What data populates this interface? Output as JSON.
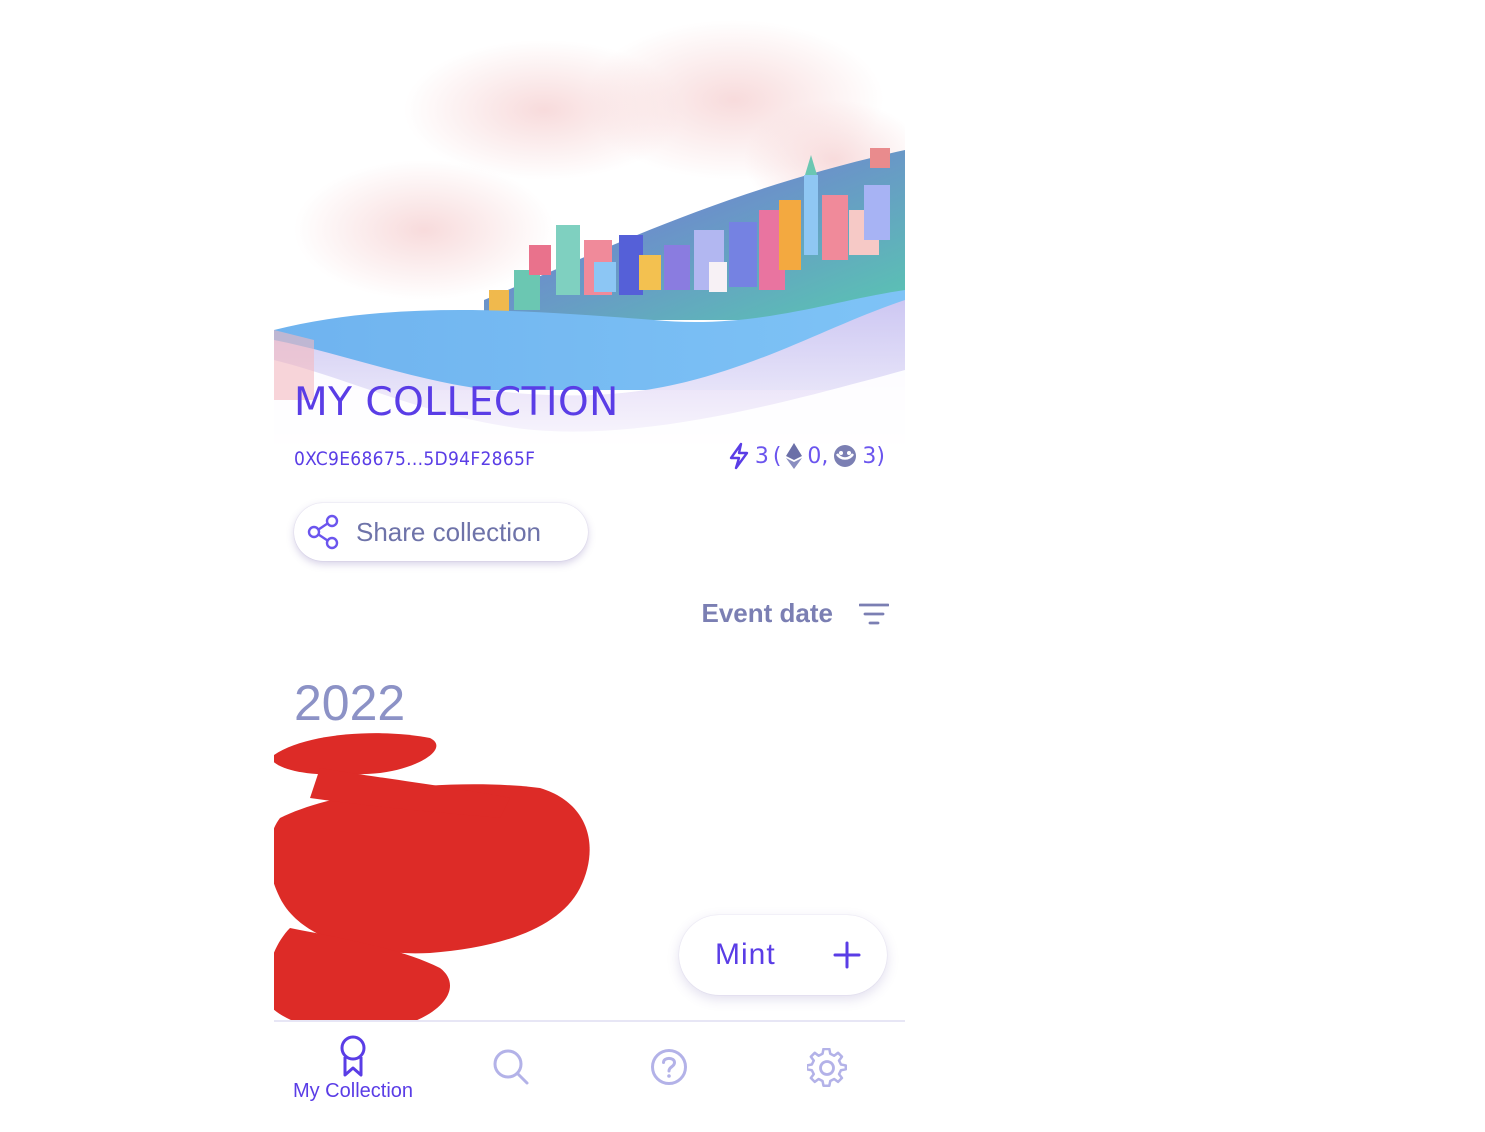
{
  "header": {
    "title": "MY COLLECTION",
    "address": "0XC9E68675...5D94F2865F"
  },
  "stats": {
    "total": "3",
    "open_paren": "(",
    "eth_count": "0,",
    "gnosis_count": "3)",
    "bolt_icon": "lightning-bolt-icon",
    "eth_icon": "ethereum-icon",
    "gnosis_icon": "gnosis-icon"
  },
  "share": {
    "label": "Share collection",
    "icon": "share-icon"
  },
  "sort": {
    "label": "Event date",
    "icon": "filter-lines-icon"
  },
  "year_heading": "2022",
  "mint": {
    "label": "Mint",
    "icon": "plus-icon"
  },
  "tabs": [
    {
      "label": "My Collection",
      "icon": "badge-ribbon-icon",
      "active": true
    },
    {
      "label": "",
      "icon": "search-icon",
      "active": false
    },
    {
      "label": "",
      "icon": "help-circle-icon",
      "active": false
    },
    {
      "label": "",
      "icon": "gear-icon",
      "active": false
    }
  ],
  "colors": {
    "accent": "#5a3de6",
    "muted": "#7b7fb3",
    "tab_inactive": "#b3b2e8",
    "redaction": "#dd2b27"
  }
}
